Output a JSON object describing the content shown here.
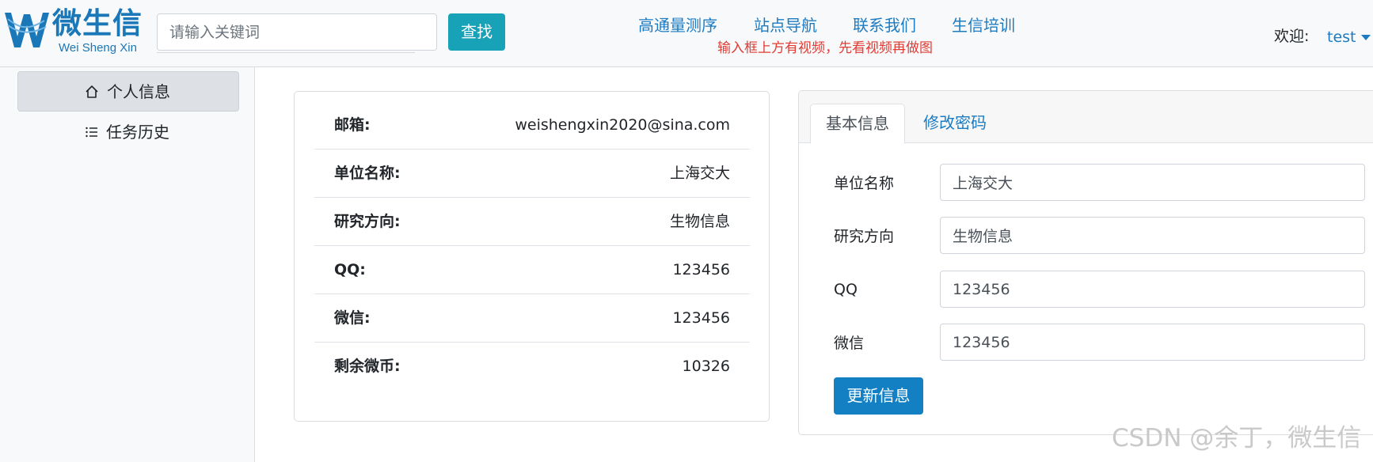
{
  "header": {
    "logo_cn": "微生信",
    "logo_en": "Wei Sheng Xin",
    "search_placeholder": "请输入关键词",
    "search_button": "查找",
    "nav": [
      "高通量测序",
      "站点导航",
      "联系我们",
      "生信培训"
    ],
    "notice": "输入框上方有视频，先看视频再做图",
    "welcome_label": "欢迎:",
    "username": "test"
  },
  "sidebar": {
    "items": [
      {
        "label": "个人信息",
        "icon": "home-icon",
        "active": true
      },
      {
        "label": "任务历史",
        "icon": "list-icon",
        "active": false
      }
    ]
  },
  "profile": {
    "rows": [
      {
        "key": "邮箱:",
        "value": "weishengxin2020@sina.com"
      },
      {
        "key": "单位名称:",
        "value": "上海交大"
      },
      {
        "key": "研究方向:",
        "value": "生物信息"
      },
      {
        "key": "QQ:",
        "value": "123456"
      },
      {
        "key": "微信:",
        "value": "123456"
      },
      {
        "key": "剩余微币:",
        "value": "10326"
      }
    ]
  },
  "edit": {
    "tabs": [
      "基本信息",
      "修改密码"
    ],
    "fields": [
      {
        "label": "单位名称",
        "value": "上海交大"
      },
      {
        "label": "研究方向",
        "value": "生物信息"
      },
      {
        "label": "QQ",
        "value": "123456"
      },
      {
        "label": "微信",
        "value": "123456"
      }
    ],
    "submit": "更新信息"
  },
  "watermark": "CSDN @余丁，微生信",
  "colors": {
    "brand": "#1a77b8",
    "link": "#1b7bc2",
    "search_button": "#17a2b8",
    "primary_button": "#1380c4",
    "notice": "#e23b34"
  }
}
